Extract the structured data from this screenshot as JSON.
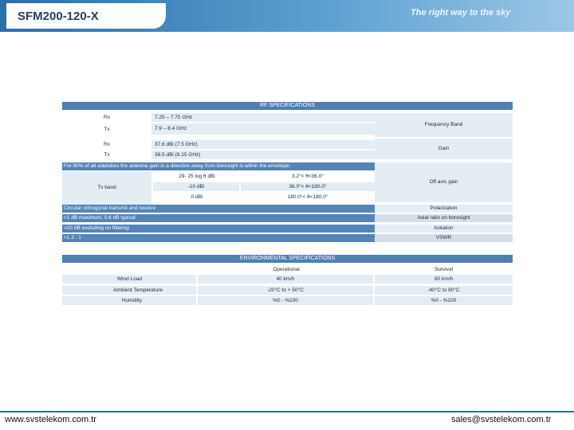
{
  "header": {
    "title": "SFM200-120-X",
    "slogan": "The right way to the sky"
  },
  "rf": {
    "heading": "RF SPECIFICATIONS",
    "rx_label": "Rx",
    "rx_freq": "7.25 – 7.75 GHz",
    "tx_label": "Tx",
    "tx_freq": "7.9 – 8.4 GHz",
    "freq_band": "Frequency Band",
    "rx_gain_label": "Rx",
    "rx_gain": "37.6 dBi (7.5 GHz)",
    "tx_gain_label": "Tx",
    "tx_gain": "38.5 dBi (8.15 GHz)",
    "gain": "Gain",
    "sidelobe_note": "For 90% of all sidelobes the antenna gain in a direction away from boresight is within the envelope:",
    "tx_band": "Tx band",
    "env_r1c1": "29- 25 log θ dBi",
    "env_r1c2": "3.2°< θ<36.0°",
    "env_r2c1": "-10 dBi",
    "env_r2c2": "36.0°< θ<180.0°",
    "env_r3c1": "0 dBi",
    "env_r3c2": "180.0°< θ<180.0°",
    "off_axis": "Off axis gain",
    "pol_value": "Circular orthogonal transmit and receive",
    "pol_label": "Polarization",
    "axial_value": "<1 dB maximum, 0.6 dB typical",
    "axial_label": "Axial ratio on boresight",
    "iso_value": ">20 dB excluding on filtering",
    "iso_label": "Isolation",
    "vswr_value": "<1.3 : 1",
    "vswr_label": "VSWR"
  },
  "env": {
    "heading": "ENVIRONMENTAL SPECIFICATIONS",
    "col_operational": "Operational",
    "col_survival": "Survival",
    "rows": [
      {
        "label": "Wind Load",
        "op": "40 km/h",
        "sv": "80 km/h"
      },
      {
        "label": "Ambient Temperature",
        "op": "-20°C to + 50°C",
        "sv": "-40°C to 80°C"
      },
      {
        "label": "Humidity",
        "op": "%0 - %100",
        "sv": "%0 - %100"
      }
    ]
  },
  "footer": {
    "website": "www.svstelekom.com.tr",
    "email": "sales@svstelekom.com.tr"
  },
  "colors": {
    "header_blue": "#2a6fa8",
    "table_bar": "#4f7fb0",
    "table_cell": "#e4ecf4"
  }
}
